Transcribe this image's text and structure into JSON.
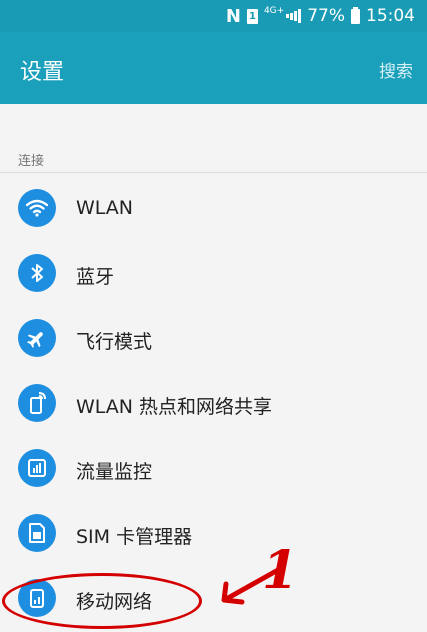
{
  "status_bar": {
    "carrier_icon": "N",
    "sim_icon": "1",
    "network_type": "4G+",
    "battery_percent": "77%",
    "time": "15:04"
  },
  "app_bar": {
    "title": "设置",
    "search_label": "搜索"
  },
  "section": {
    "header": "连接"
  },
  "items": [
    {
      "label": "WLAN",
      "icon": "wifi-icon"
    },
    {
      "label": "蓝牙",
      "icon": "bluetooth-icon"
    },
    {
      "label": "飞行模式",
      "icon": "airplane-icon"
    },
    {
      "label": "WLAN 热点和网络共享",
      "icon": "hotspot-icon"
    },
    {
      "label": "流量监控",
      "icon": "data-usage-icon"
    },
    {
      "label": "SIM 卡管理器",
      "icon": "sim-card-icon"
    },
    {
      "label": "移动网络",
      "icon": "mobile-network-icon"
    }
  ],
  "annotation": {
    "number": "1"
  },
  "colors": {
    "app_bar": "#1ba0bb",
    "icon_bg": "#1e8fe0",
    "annotation": "#d40000"
  }
}
